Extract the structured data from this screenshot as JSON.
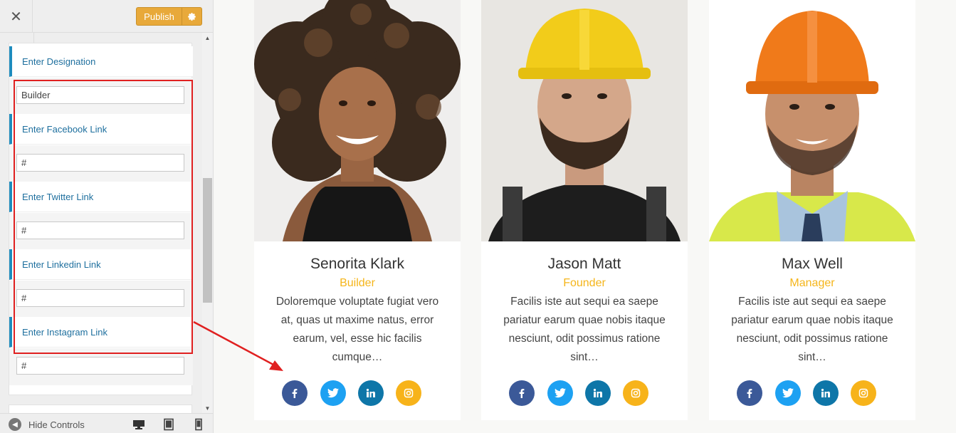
{
  "sidebar": {
    "close_icon": "close-icon",
    "publish_label": "Publish",
    "settings_icon": "gear-icon",
    "designation": {
      "label": "Enter Designation",
      "value": "Builder"
    },
    "facebook": {
      "label": "Enter Facebook Link",
      "value": "#"
    },
    "twitter": {
      "label": "Enter Twitter Link",
      "value": "#"
    },
    "linkedin": {
      "label": "Enter Linkedin Link",
      "value": "#"
    },
    "instagram": {
      "label": "Enter Instagram Link",
      "value": "#"
    },
    "hide_controls_label": "Hide Controls",
    "devices": [
      "desktop-icon",
      "tablet-icon",
      "mobile-icon"
    ]
  },
  "team": [
    {
      "name": "Senorita Klark",
      "role": "Builder",
      "description": "Doloremque voluptate fugiat vero at, quas ut maxime natus, error earum, vel, esse hic facilis cumque…",
      "photo": "woman-curly-hair-photo"
    },
    {
      "name": "Jason Matt",
      "role": "Founder",
      "description": "Facilis iste aut sequi ea saepe pariatur earum quae nobis itaque nesciunt, odit possimus ratione sint…",
      "photo": "man-yellow-helmet-photo"
    },
    {
      "name": "Max Well",
      "role": "Manager",
      "description": "Facilis iste aut sequi ea saepe pariatur earum quae nobis itaque nesciunt, odit possimus ratione sint…",
      "photo": "man-orange-helmet-photo"
    }
  ],
  "social": [
    {
      "name": "facebook",
      "icon": "f",
      "color": "#3b5998"
    },
    {
      "name": "twitter",
      "icon": "twitter-bird-icon",
      "color": "#1da1f2"
    },
    {
      "name": "linkedin",
      "icon": "in",
      "color": "#0e76a8"
    },
    {
      "name": "instagram",
      "icon": "instagram-icon",
      "color": "#f7b31a"
    }
  ],
  "colors": {
    "accent": "#f5b51a",
    "link": "#1e8cbe",
    "publish": "#e8a93a",
    "highlight": "#e02020"
  }
}
